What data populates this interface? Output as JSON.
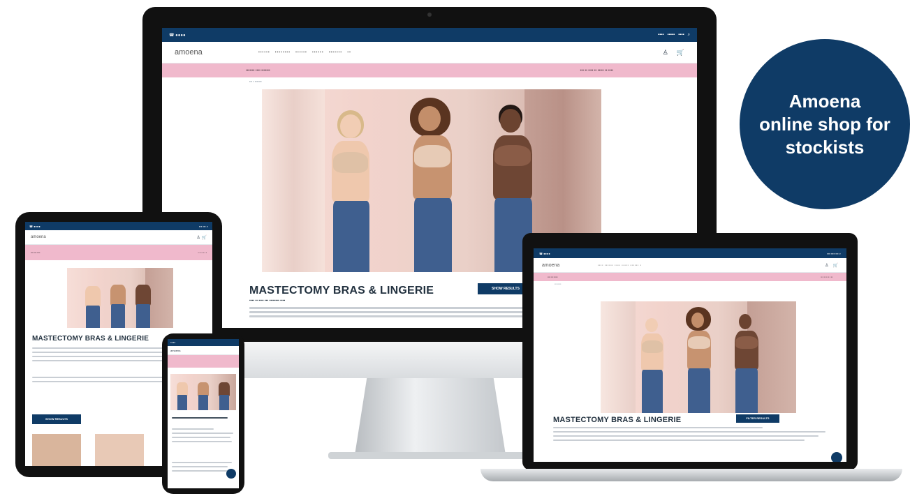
{
  "badge": {
    "line1": "Amoena",
    "line2": "online shop for",
    "line3": "stockists"
  },
  "site": {
    "logo": "amoena",
    "heading": "MASTECTOMY BRAS & LINGERIE",
    "subheading": "What is Open cup lingerie bra? ...",
    "cta_label": "SHOW RESULTS",
    "cta_label_laptop": "FILTER RESULTS"
  },
  "colors": {
    "brand_navy": "#0f3b66",
    "promo_pink": "#f0b9cc",
    "hero_peach": "#f2d3cc"
  },
  "icons": [
    "phone-icon",
    "social-icons",
    "search-icon",
    "user-icon",
    "cart-icon",
    "chat-icon"
  ]
}
